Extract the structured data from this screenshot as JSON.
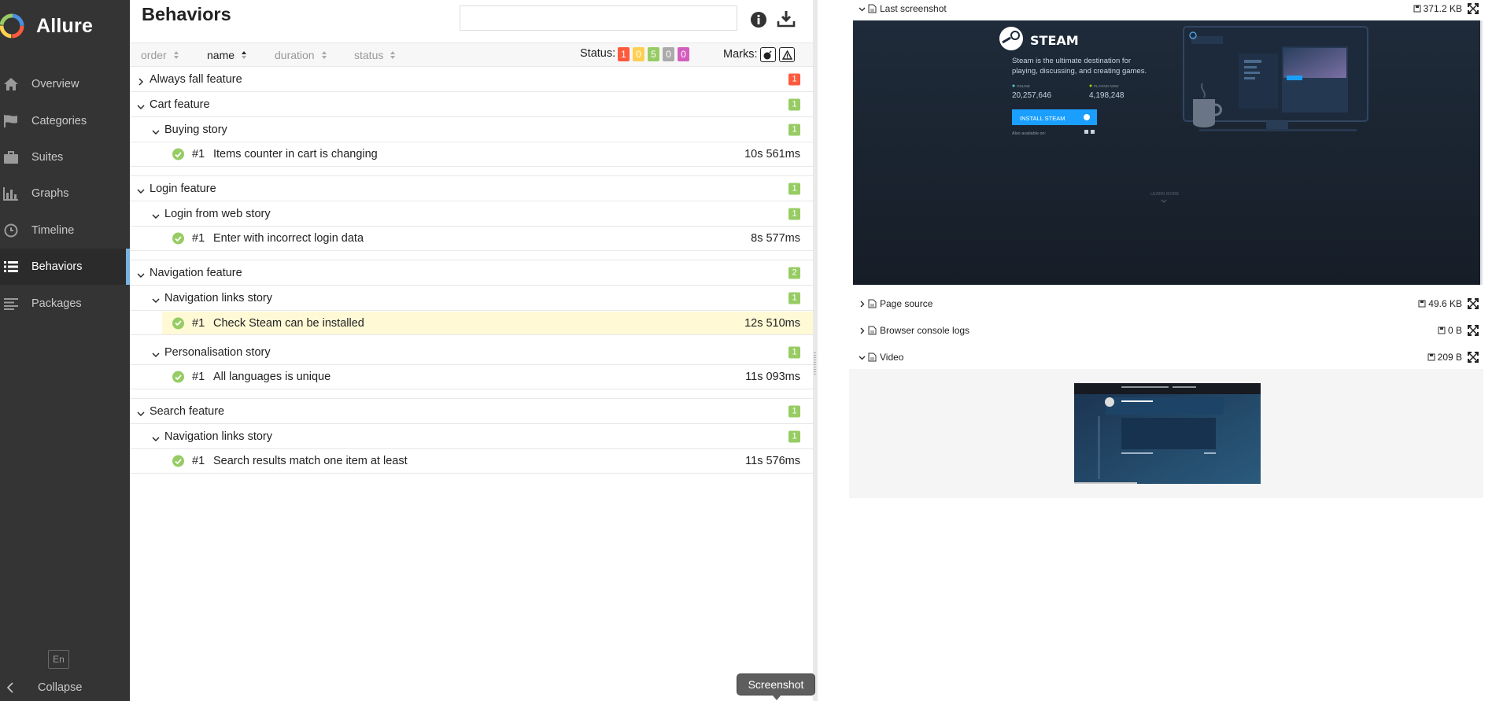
{
  "app": {
    "brand": "Allure",
    "language": "En",
    "collapse_label": "Collapse"
  },
  "sidebar": {
    "items": [
      {
        "label": "Overview",
        "icon": "home-icon"
      },
      {
        "label": "Categories",
        "icon": "flag-icon"
      },
      {
        "label": "Suites",
        "icon": "briefcase-icon"
      },
      {
        "label": "Graphs",
        "icon": "bar-chart-icon"
      },
      {
        "label": "Timeline",
        "icon": "clock-icon"
      },
      {
        "label": "Behaviors",
        "icon": "list-icon",
        "active": true
      },
      {
        "label": "Packages",
        "icon": "align-left-icon"
      }
    ]
  },
  "main": {
    "title": "Behaviors",
    "search_value": "",
    "sorters": [
      "order",
      "name",
      "duration",
      "status"
    ],
    "active_sorter": "name",
    "status_label": "Status:",
    "status_counts": [
      {
        "value": "1",
        "color": "#fd5a3e"
      },
      {
        "value": "0",
        "color": "#ffd050"
      },
      {
        "value": "5",
        "color": "#97cc64"
      },
      {
        "value": "0",
        "color": "#aaaaaa"
      },
      {
        "value": "0",
        "color": "#d35ebe"
      }
    ],
    "marks_label": "Marks:"
  },
  "tree": [
    {
      "type": "feature",
      "label": "Always fall feature",
      "count": "1",
      "count_color": "#fd5a3e",
      "expanded": false
    },
    {
      "type": "feature",
      "label": "Cart feature",
      "count": "1",
      "count_color": "#97cc64",
      "expanded": true
    },
    {
      "type": "story",
      "label": "Buying story",
      "count": "1",
      "count_color": "#97cc64"
    },
    {
      "type": "test",
      "num": "#1",
      "label": "Items counter in cart is changing",
      "duration": "10s 561ms"
    },
    {
      "type": "feature",
      "label": "Login feature",
      "count": "1",
      "count_color": "#97cc64",
      "expanded": true
    },
    {
      "type": "story",
      "label": "Login from web story",
      "count": "1",
      "count_color": "#97cc64"
    },
    {
      "type": "test",
      "num": "#1",
      "label": "Enter with incorrect login data",
      "duration": "8s 577ms"
    },
    {
      "type": "feature",
      "label": "Navigation feature",
      "count": "2",
      "count_color": "#97cc64",
      "expanded": true
    },
    {
      "type": "story",
      "label": "Navigation links story",
      "count": "1",
      "count_color": "#97cc64"
    },
    {
      "type": "test",
      "num": "#1",
      "label": "Check Steam can be installed",
      "duration": "12s 510ms",
      "selected": true
    },
    {
      "type": "story",
      "label": "Personalisation story",
      "count": "1",
      "count_color": "#97cc64"
    },
    {
      "type": "test",
      "num": "#1",
      "label": "All languages is unique",
      "duration": "11s 093ms"
    },
    {
      "type": "feature",
      "label": "Search feature",
      "count": "1",
      "count_color": "#97cc64",
      "expanded": true
    },
    {
      "type": "story",
      "label": "Navigation links story",
      "count": "1",
      "count_color": "#97cc64"
    },
    {
      "type": "test",
      "num": "#1",
      "label": "Search results match one item at least",
      "duration": "11s 576ms"
    }
  ],
  "tooltip": "Screenshot",
  "attachments": [
    {
      "name": "Last screenshot",
      "size": "371.2 KB",
      "expanded": true
    },
    {
      "name": "Page source",
      "size": "49.6 KB",
      "expanded": false
    },
    {
      "name": "Browser console logs",
      "size": "0 B",
      "expanded": false
    },
    {
      "name": "Video",
      "size": "209 B",
      "expanded": true
    }
  ],
  "screenshot": {
    "brand": "STEAM",
    "tagline_1": "Steam is the ultimate destination for",
    "tagline_2": "playing, discussing, and creating games.",
    "online_label": "ONLINE",
    "online_value": "20,257,646",
    "playing_label": "PLAYING NOW",
    "playing_value": "4,198,248",
    "install_label": "INSTALL STEAM",
    "available_label": "Also available on:",
    "learn_more": "LEARN MORE"
  }
}
